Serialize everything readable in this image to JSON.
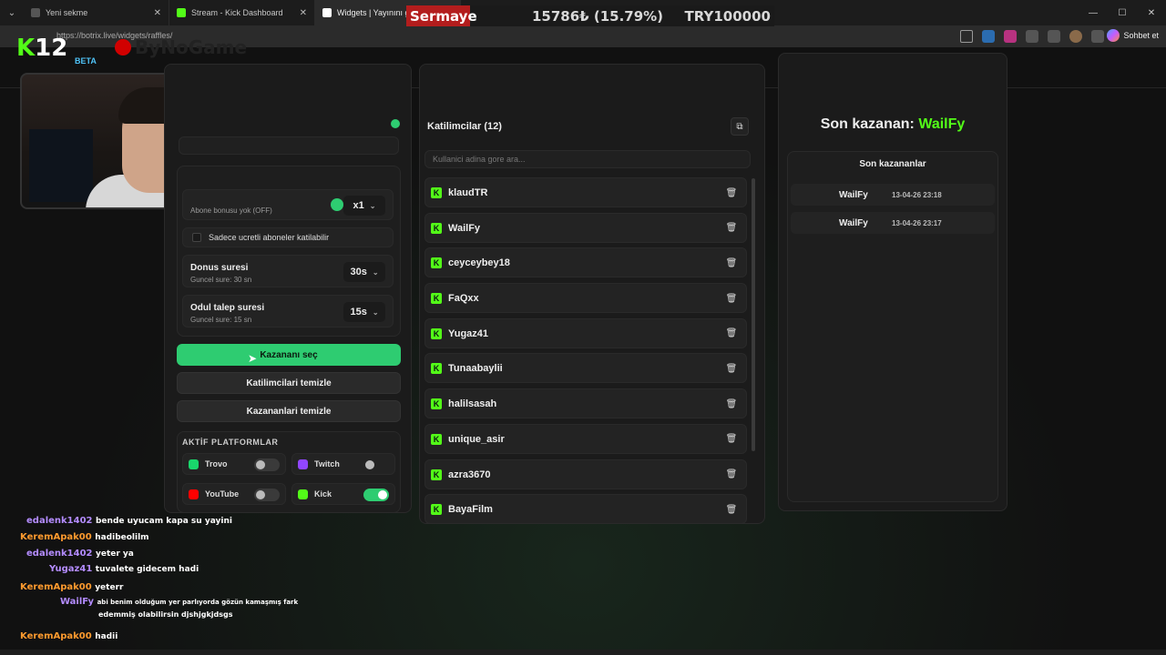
{
  "browser": {
    "tabs": [
      {
        "label": "Yeni sekme",
        "icon_color": "#555555"
      },
      {
        "label": "Stream - Kick Dashboard",
        "icon_color": "#53fc18"
      },
      {
        "label": "Widgets | Yayınını güç",
        "icon_color": "#ffffff"
      }
    ],
    "url": "https://botrix.live/widgets/raffles/",
    "chat_button": "Sohbet et"
  },
  "overlay": {
    "sermaye_label": "Sermaye",
    "sermaye_value": "15786₺ (15.79%)",
    "capital": "TRY100000",
    "channel_badge": "12",
    "brand": "ByNoGame",
    "beta": "BETA"
  },
  "raffle_settings": {
    "subscriber_bonus_sub": "Abone bonusu yok (OFF)",
    "multiplier": "x1",
    "subscribers_only_label": "Sadece ucretli aboneler katilabilir",
    "spin_duration_title": "Donus suresi",
    "spin_duration_sub": "Guncel sure: 30 sn",
    "spin_duration_value": "30s",
    "claim_duration_title": "Odul talep suresi",
    "claim_duration_sub": "Guncel sure: 15 sn",
    "claim_duration_value": "15s",
    "pick_winner_button": "Kazananı seç",
    "clear_participants_button": "Katilimcilari temizle",
    "clear_winners_button": "Kazananlari temizle",
    "platforms_title": "AKTİF PLATFORMLAR",
    "platforms": [
      {
        "name": "Trovo",
        "enabled": false,
        "color": "#19d66b"
      },
      {
        "name": "Twitch",
        "enabled": false,
        "color": "#9146ff"
      },
      {
        "name": "YouTube",
        "enabled": false,
        "color": "#ff0000"
      },
      {
        "name": "Kick",
        "enabled": true,
        "color": "#53fc18"
      }
    ]
  },
  "participants": {
    "title": "Katilimcilar (12)",
    "search_placeholder": "Kullanici adina gore ara...",
    "items": [
      "klaudTR",
      "WailFy",
      "ceyceybey18",
      "FaQxx",
      "Yugaz41",
      "Tunaabaylii",
      "halilsasah",
      "unique_asir",
      "azra3670",
      "BayaFilm"
    ]
  },
  "winners": {
    "last_winner_label": "Son kazanan:",
    "last_winner_name": "WailFy",
    "list_title": "Son kazananlar",
    "items": [
      {
        "name": "WailFy",
        "date": "13-04-26 23:18"
      },
      {
        "name": "WailFy",
        "date": "13-04-26 23:17"
      }
    ]
  },
  "chat": [
    {
      "user": "edalenk1402",
      "color": "#b48cff",
      "msg": "bende uyucam kapa su yayini"
    },
    {
      "user": "KeremApak00",
      "color": "#ff9a2e",
      "msg": "hadibeolilm"
    },
    {
      "user": "edalenk1402",
      "color": "#b48cff",
      "msg": "yeter ya"
    },
    {
      "user": "Yugaz41",
      "color": "#b48cff",
      "msg": "tuvalete gidecem hadi"
    },
    {
      "user": "KeremApak00",
      "color": "#ff9a2e",
      "msg": "yeterr"
    },
    {
      "user": "WailFy",
      "color": "#b48cff",
      "msg": "abi benim olduğum yer parlıyorda gözün kamaşmış fark"
    },
    {
      "user": "",
      "color": "#ffffff",
      "msg": "edemmiş olabilirsin djshjgkjdsgs"
    },
    {
      "user": "KeremApak00",
      "color": "#ff9a2e",
      "msg": "hadii"
    }
  ]
}
